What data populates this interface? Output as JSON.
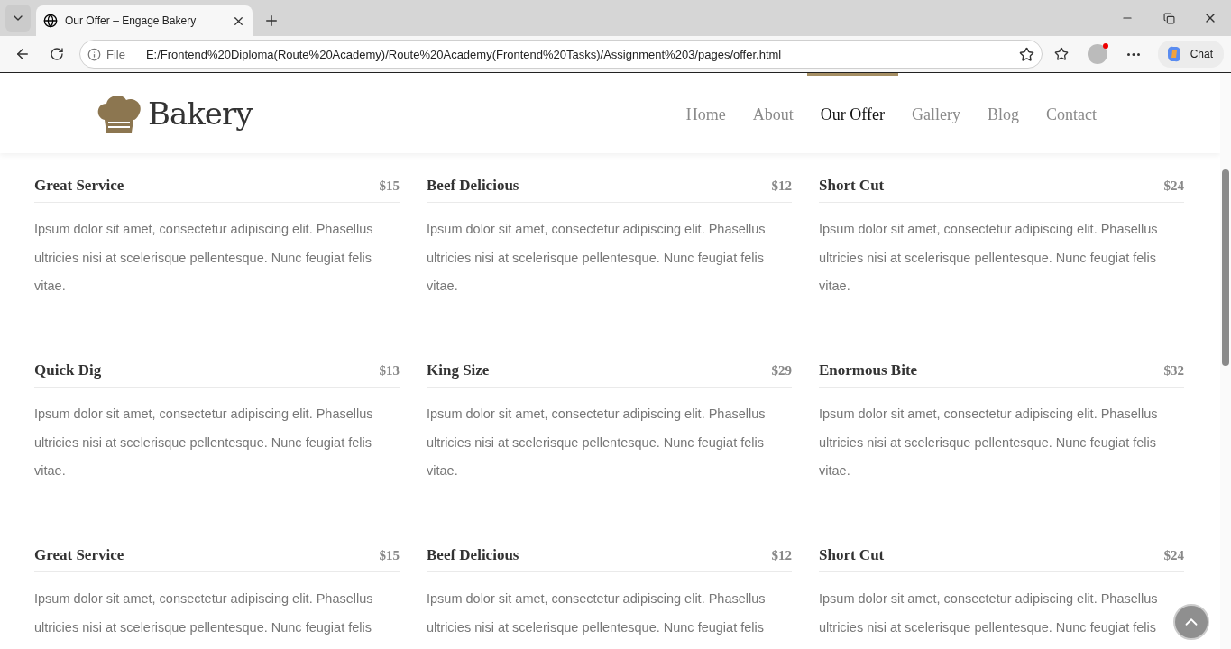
{
  "browser": {
    "tab_title": "Our Offer – Engage Bakery",
    "file_label": "File",
    "url": "E:/Frontend%20Diploma(Route%20Academy)/Route%20Academy(Frontend%20Tasks)/Assignment%203/pages/offer.html",
    "chat_label": "Chat"
  },
  "logo": {
    "text": "Bakery"
  },
  "nav": [
    {
      "label": "Home",
      "selected": false
    },
    {
      "label": "About",
      "selected": false
    },
    {
      "label": "Our Offer",
      "selected": true
    },
    {
      "label": "Gallery",
      "selected": false
    },
    {
      "label": "Blog",
      "selected": false
    },
    {
      "label": "Contact",
      "selected": false
    }
  ],
  "offers": [
    {
      "title": "Great Service",
      "price": "$15",
      "description": "Ipsum dolor sit amet, consectetur adipiscing elit. Phasellus ultricies nisi at scelerisque pellentesque. Nunc feugiat felis vitae."
    },
    {
      "title": "Beef Delicious",
      "price": "$12",
      "description": "Ipsum dolor sit amet, consectetur adipiscing elit. Phasellus ultricies nisi at scelerisque pellentesque. Nunc feugiat felis vitae."
    },
    {
      "title": "Short Cut",
      "price": "$24",
      "description": "Ipsum dolor sit amet, consectetur adipiscing elit. Phasellus ultricies nisi at scelerisque pellentesque. Nunc feugiat felis vitae."
    },
    {
      "title": "Quick Dig",
      "price": "$13",
      "description": "Ipsum dolor sit amet, consectetur adipiscing elit. Phasellus ultricies nisi at scelerisque pellentesque. Nunc feugiat felis vitae."
    },
    {
      "title": "King Size",
      "price": "$29",
      "description": "Ipsum dolor sit amet, consectetur adipiscing elit. Phasellus ultricies nisi at scelerisque pellentesque. Nunc feugiat felis vitae."
    },
    {
      "title": "Enormous Bite",
      "price": "$32",
      "description": "Ipsum dolor sit amet, consectetur adipiscing elit. Phasellus ultricies nisi at scelerisque pellentesque. Nunc feugiat felis vitae."
    },
    {
      "title": "Great Service",
      "price": "$15",
      "description": "Ipsum dolor sit amet, consectetur adipiscing elit. Phasellus ultricies nisi at scelerisque pellentesque. Nunc feugiat felis"
    },
    {
      "title": "Beef Delicious",
      "price": "$12",
      "description": "Ipsum dolor sit amet, consectetur adipiscing elit. Phasellus ultricies nisi at scelerisque pellentesque. Nunc feugiat felis"
    },
    {
      "title": "Short Cut",
      "price": "$24",
      "description": "Ipsum dolor sit amet, consectetur adipiscing elit. Phasellus ultricies nisi at scelerisque pellentesque. Nunc feugiat felis"
    }
  ]
}
